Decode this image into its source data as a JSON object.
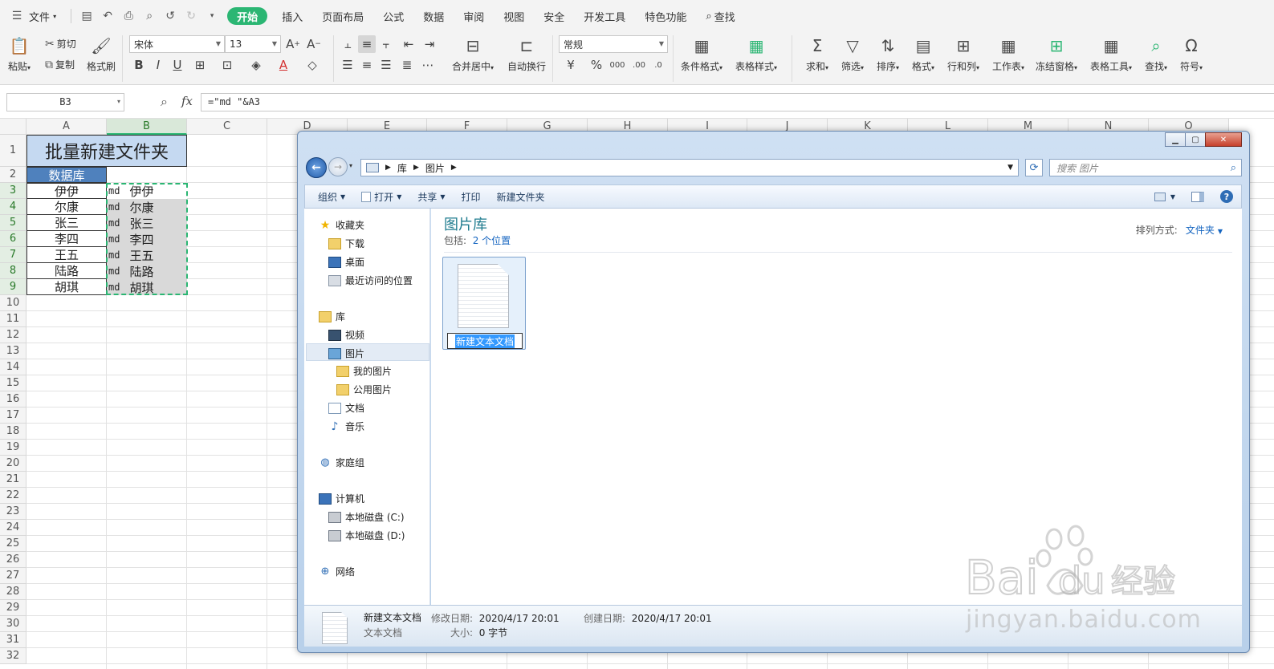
{
  "menubar": {
    "file_label": "文件",
    "items": [
      "开始",
      "插入",
      "页面布局",
      "公式",
      "数据",
      "审阅",
      "视图",
      "安全",
      "开发工具",
      "特色功能"
    ],
    "search_label": "查找"
  },
  "ribbon": {
    "paste": "粘贴",
    "cut": "剪切",
    "copy": "复制",
    "format_painter": "格式刷",
    "font_name": "宋体",
    "font_size": "13",
    "merge_center": "合并居中",
    "wrap_text": "自动换行",
    "number_format": "常规",
    "cond_format": "条件格式",
    "table_style": "表格样式",
    "sum": "求和",
    "filter": "筛选",
    "sort": "排序",
    "format": "格式",
    "row_col": "行和列",
    "worksheet": "工作表",
    "freeze": "冻结窗格",
    "table_tools": "表格工具",
    "find": "查找",
    "symbol": "符号"
  },
  "formula_bar": {
    "name_box": "B3",
    "fx": "fx",
    "formula": "=\"md \"&A3"
  },
  "sheet": {
    "columns": [
      "A",
      "B",
      "C",
      "D",
      "E",
      "F",
      "G",
      "H",
      "I",
      "J",
      "K",
      "L",
      "M",
      "N",
      "O"
    ],
    "rows": [
      "1",
      "2",
      "3",
      "4",
      "5",
      "6",
      "7",
      "8",
      "9",
      "10",
      "11",
      "12",
      "13",
      "14",
      "15",
      "16",
      "17",
      "18",
      "19",
      "20",
      "21",
      "22",
      "23",
      "24",
      "25",
      "26",
      "27",
      "28",
      "29",
      "30",
      "31",
      "32"
    ],
    "title": "批量新建文件夹",
    "header": "数据库",
    "names": [
      "伊伊",
      "尔康",
      "张三",
      "李四",
      "王五",
      "陆路",
      "胡琪"
    ],
    "md_prefix": "md",
    "selected_col": "B",
    "selected_rows": [
      "3",
      "4",
      "5",
      "6",
      "7",
      "8",
      "9"
    ]
  },
  "explorer": {
    "address": [
      "库",
      "图片"
    ],
    "search_placeholder": "搜索 图片",
    "toolbar": [
      "组织",
      "打开",
      "共享",
      "打印",
      "新建文件夹"
    ],
    "nav": {
      "favorites": "收藏夹",
      "downloads": "下载",
      "desktop": "桌面",
      "recent": "最近访问的位置",
      "libraries": "库",
      "videos": "视频",
      "pictures": "图片",
      "my_pictures": "我的图片",
      "public_pictures": "公用图片",
      "documents": "文档",
      "music": "音乐",
      "homegroup": "家庭组",
      "computer": "计算机",
      "disk_c": "本地磁盘 (C:)",
      "disk_d": "本地磁盘 (D:)",
      "network": "网络"
    },
    "library_title": "图片库",
    "includes_label": "包括:",
    "includes_link": "2 个位置",
    "sort_label": "排列方式:",
    "sort_value": "文件夹",
    "file_name": "新建文本文档",
    "details": {
      "name": "新建文本文档",
      "type": "文本文档",
      "modified_label": "修改日期:",
      "modified": "2020/4/17 20:01",
      "created_label": "创建日期:",
      "created": "2020/4/17 20:01",
      "size_label": "大小:",
      "size": "0 字节"
    }
  },
  "watermark": {
    "text": "jingyan.baidu.com",
    "brand": "Bai",
    "brand2": "du",
    "brand_cn": "经验"
  }
}
